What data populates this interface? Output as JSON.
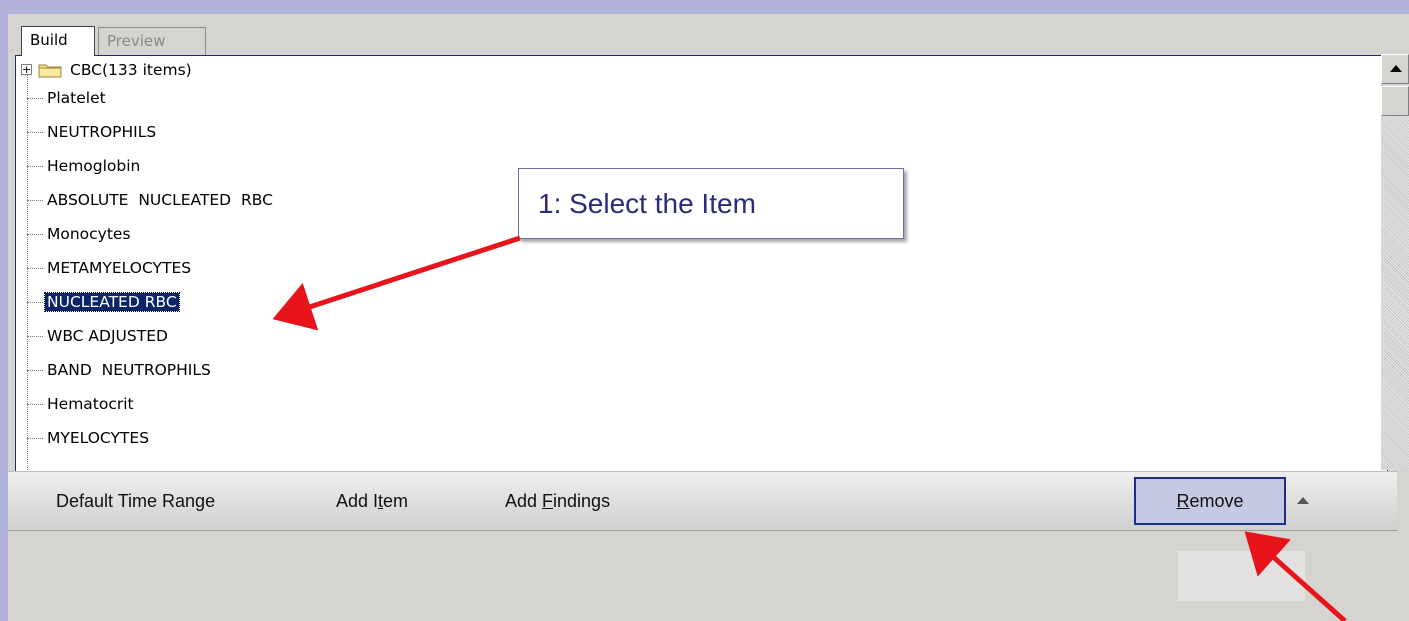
{
  "tabs": [
    {
      "label": "Build",
      "active": true
    },
    {
      "label": "Preview",
      "active": false
    }
  ],
  "tree": {
    "folder": {
      "label": "CBC(133 items)",
      "expander": "+"
    },
    "items": [
      {
        "label": "Platelet"
      },
      {
        "label": "NEUTROPHILS"
      },
      {
        "label": "Hemoglobin"
      },
      {
        "label": "ABSOLUTE  NUCLEATED  RBC"
      },
      {
        "label": "Monocytes"
      },
      {
        "label": "METAMYELOCYTES"
      },
      {
        "label": "NUCLEATED RBC",
        "selected": true
      },
      {
        "label": "WBC ADJUSTED"
      },
      {
        "label": "BAND  NEUTROPHILS"
      },
      {
        "label": "Hematocrit"
      },
      {
        "label": "MYELOCYTES"
      }
    ]
  },
  "toolbar": {
    "default_time_range": "Default Time Range",
    "add_item_pre": "Add I",
    "add_item_u": "t",
    "add_item_post": "em",
    "add_findings_pre": "Add ",
    "add_findings_u": "F",
    "add_findings_post": "indings",
    "remove_u": "R",
    "remove_post": "emove"
  },
  "callout": {
    "text": "1: Select the Item"
  },
  "colors": {
    "background": "#b3b3dc",
    "selection": "#0a246a",
    "annotation_arrow": "#e8141c",
    "callout_text": "#2b2b7a"
  }
}
